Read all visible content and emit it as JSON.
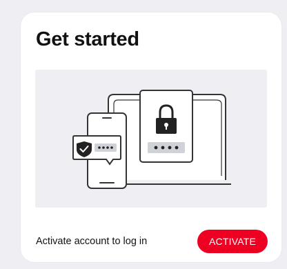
{
  "card": {
    "title": "Get started",
    "footer_text": "Activate account to log in",
    "activate_label": "ACTIVATE"
  },
  "illustration": {
    "icons": [
      "laptop-icon",
      "lock-icon",
      "smartphone-icon",
      "shield-check-icon",
      "password-dots-icon"
    ]
  },
  "colors": {
    "background": "#efeff3",
    "card": "#ffffff",
    "accent": "#ee0022",
    "text": "#111111",
    "illustration_bg": "#efeff3"
  }
}
